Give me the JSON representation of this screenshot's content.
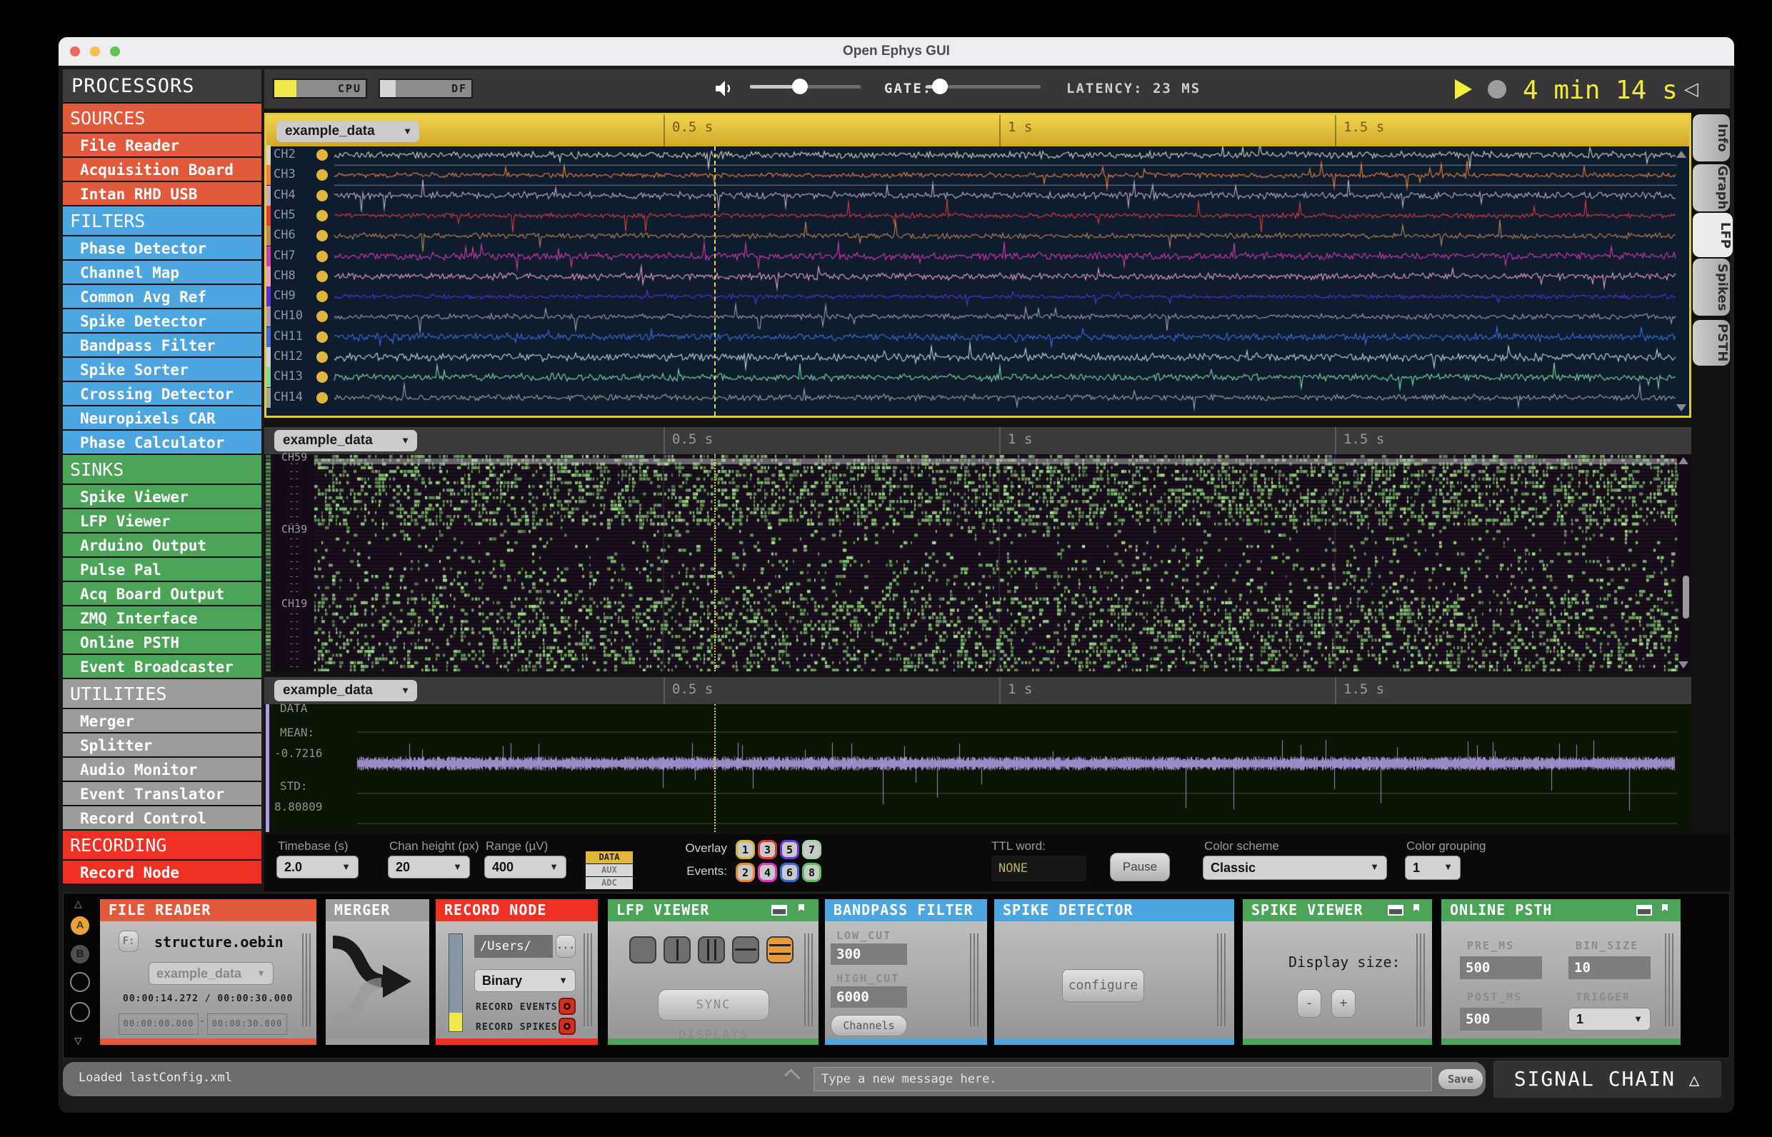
{
  "window": {
    "title": "Open Ephys GUI"
  },
  "toolbar": {
    "cpu_label": "CPU",
    "df_label": "DF",
    "gate_label": "GATE:",
    "latency_label": "LATENCY: 23 MS",
    "timer": "4 min 14 s",
    "cpu_fill_pct": 24,
    "df_fill_pct": 17,
    "volume_pct": 45,
    "gate_pct": 12
  },
  "sidebar": {
    "title": "PROCESSORS",
    "sections": [
      {
        "label": "SOURCES",
        "color": "#E2593B",
        "items": [
          "File Reader",
          "Acquisition Board",
          "Intan RHD USB"
        ]
      },
      {
        "label": "FILTERS",
        "color": "#4DA6E0",
        "items": [
          "Phase Detector",
          "Channel Map",
          "Common Avg Ref",
          "Spike Detector",
          "Bandpass Filter",
          "Spike Sorter",
          "Crossing Detector",
          "Neuropixels CAR",
          "Phase Calculator"
        ]
      },
      {
        "label": "SINKS",
        "color": "#4BA458",
        "items": [
          "Spike Viewer",
          "LFP Viewer",
          "Arduino Output",
          "Pulse Pal",
          "Acq Board Output",
          "ZMQ Interface",
          "Online PSTH",
          "Event Broadcaster"
        ]
      },
      {
        "label": "UTILITIES",
        "color": "#9C9C9C",
        "items": [
          "Merger",
          "Splitter",
          "Audio Monitor",
          "Event Translator",
          "Record Control"
        ]
      },
      {
        "label": "RECORDING",
        "color": "#EE3124",
        "items": [
          "Record Node"
        ]
      }
    ]
  },
  "viewers": {
    "time_labels": [
      "0.5 s",
      "1 s",
      "1.5 s"
    ],
    "lfp": {
      "source": "example_data",
      "channels": [
        {
          "name": "CH2",
          "color": "#D7D2C3"
        },
        {
          "name": "CH3",
          "color": "#ED8239"
        },
        {
          "name": "CH4",
          "color": "#C3AEC9"
        },
        {
          "name": "CH5",
          "color": "#E23B3B"
        },
        {
          "name": "CH6",
          "color": "#BE8755"
        },
        {
          "name": "CH7",
          "color": "#D23BB0"
        },
        {
          "name": "CH8",
          "color": "#E9A1C8"
        },
        {
          "name": "CH9",
          "color": "#5B2FE0"
        },
        {
          "name": "CH10",
          "color": "#A79BB5"
        },
        {
          "name": "CH11",
          "color": "#3B6FE0"
        },
        {
          "name": "CH12",
          "color": "#C8D2E2"
        },
        {
          "name": "CH13",
          "color": "#7FD9A2"
        },
        {
          "name": "CH14",
          "color": "#9FA5A5"
        }
      ]
    },
    "raster": {
      "source": "example_data",
      "channel_labels": [
        "CH59",
        "CH39",
        "CH19"
      ],
      "tick_mark": "--"
    },
    "stats": {
      "source": "example_data",
      "data_label": "DATA",
      "mean_label": "MEAN:",
      "mean_value": "-0.7216",
      "std_label": "STD:",
      "std_value": "8.80809"
    }
  },
  "lfp_controls": {
    "timebase_label": "Timebase (s)",
    "timebase": "2.0",
    "chan_height_label": "Chan height (px)",
    "chan_height": "20",
    "range_label": "Range (µV)",
    "range": "400",
    "signal_buttons": [
      "DATA",
      "AUX",
      "ADC"
    ],
    "overlay_label_1": "Overlay",
    "overlay_label_2": "Events:",
    "event_buttons": [
      {
        "n": "1",
        "color": "#D4B83A"
      },
      {
        "n": "3",
        "color": "#D83A3A"
      },
      {
        "n": "5",
        "color": "#6A3AD8"
      },
      {
        "n": "7",
        "color": "#9ED89A"
      },
      {
        "n": "2",
        "color": "#E8862E"
      },
      {
        "n": "4",
        "color": "#D83AB8"
      },
      {
        "n": "6",
        "color": "#3A6AD8"
      },
      {
        "n": "8",
        "color": "#5ABF5A"
      }
    ],
    "ttl_label": "TTL word:",
    "ttl_value": "NONE",
    "pause_label": "Pause",
    "color_scheme_label": "Color scheme",
    "color_scheme": "Classic",
    "color_grouping_label": "Color grouping",
    "color_grouping": "1"
  },
  "tabs": [
    {
      "label": "Info",
      "selected": false
    },
    {
      "label": "Graph",
      "selected": false
    },
    {
      "label": "LFP",
      "selected": true
    },
    {
      "label": "Spikes",
      "selected": false
    },
    {
      "label": "PSTH",
      "selected": false
    }
  ],
  "signal_chain": {
    "rail": {
      "a": "A",
      "b": "B"
    },
    "file_reader": {
      "title": "FILE READER",
      "accent": "#E2593B",
      "f_button": "F:",
      "filename": "structure.oebin",
      "stream": "example_data",
      "time_display": "00:00:14.272 / 00:00:30.000",
      "start_time": "00:00:00.000",
      "dash": "-",
      "end_time": "00:00:30.000"
    },
    "merger": {
      "title": "MERGER",
      "accent": "#9C9C9C"
    },
    "record_node": {
      "title": "RECORD NODE",
      "accent": "#EE3124",
      "path": "/Users/",
      "ellipsis": "...",
      "engine": "Binary",
      "record_events_label": "RECORD EVENTS",
      "record_spikes_label": "RECORD SPIKES"
    },
    "lfp_viewer": {
      "title": "LFP VIEWER",
      "accent": "#4BA458",
      "sync_label": "SYNC DISPLAYS"
    },
    "bandpass": {
      "title": "BANDPASS FILTER",
      "accent": "#4DA6E0",
      "low_cut_label": "LOW_CUT",
      "low_cut": "300",
      "high_cut_label": "HIGH_CUT",
      "high_cut": "6000",
      "channels_label": "Channels"
    },
    "spike_detector": {
      "title": "SPIKE DETECTOR",
      "accent": "#4DA6E0",
      "configure_label": "configure"
    },
    "spike_viewer": {
      "title": "SPIKE VIEWER",
      "accent": "#4BA458",
      "display_size_label": "Display size:",
      "minus": "-",
      "plus": "+"
    },
    "online_psth": {
      "title": "ONLINE PSTH",
      "accent": "#4BA458",
      "pre_ms_label": "PRE_MS",
      "pre_ms": "500",
      "bin_size_label": "BIN_SIZE",
      "bin_size": "10",
      "post_ms_label": "POST_MS",
      "post_ms": "500",
      "trigger_label": "TRIGGER",
      "trigger": "1"
    }
  },
  "status_bar": {
    "message": "Loaded lastConfig.xml",
    "input_placeholder": "Type a new message here.",
    "save_label": "Save",
    "signal_chain_label": "SIGNAL CHAIN"
  }
}
